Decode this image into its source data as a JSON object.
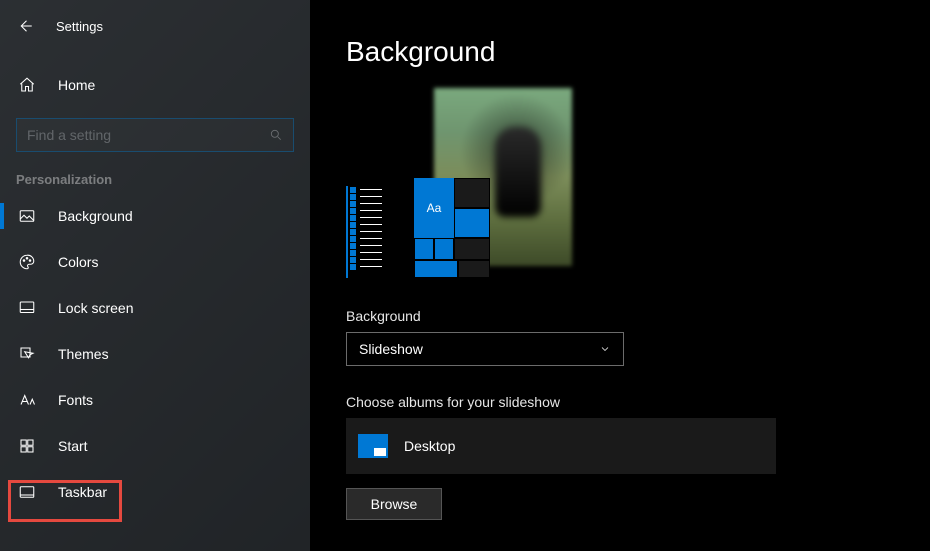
{
  "header": {
    "back": "Back",
    "title": "Settings"
  },
  "home_label": "Home",
  "search": {
    "placeholder": "Find a setting"
  },
  "section_label": "Personalization",
  "sidebar": {
    "items": [
      {
        "label": "Background"
      },
      {
        "label": "Colors"
      },
      {
        "label": "Lock screen"
      },
      {
        "label": "Themes"
      },
      {
        "label": "Fonts"
      },
      {
        "label": "Start"
      },
      {
        "label": "Taskbar"
      }
    ]
  },
  "main": {
    "heading": "Background",
    "preview_sample_text": "Aa",
    "bg_label": "Background",
    "bg_dropdown_value": "Slideshow",
    "albums_label": "Choose albums for your slideshow",
    "album_name": "Desktop",
    "browse_label": "Browse"
  },
  "highlight": {
    "target": "Taskbar"
  }
}
